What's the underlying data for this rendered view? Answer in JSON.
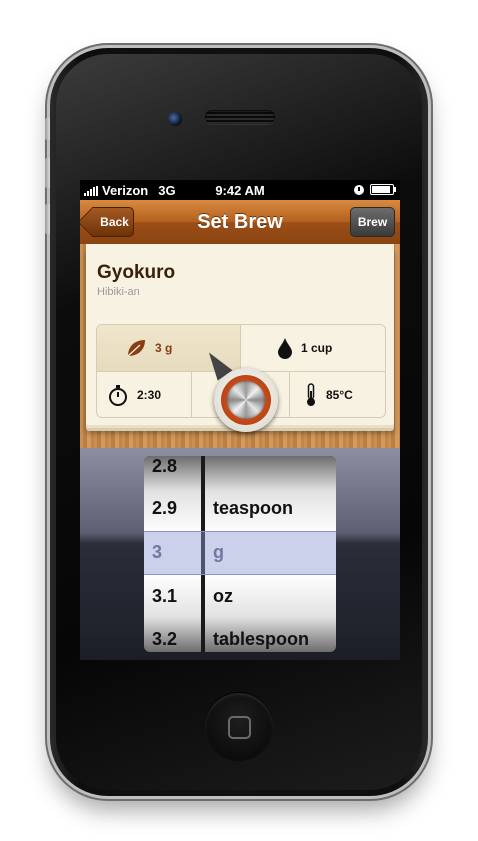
{
  "status_bar": {
    "carrier": "Verizon",
    "network": "3G",
    "time": "9:42 AM"
  },
  "nav": {
    "back_label": "Back",
    "title": "Set Brew",
    "brew_label": "Brew"
  },
  "tea": {
    "name": "Gyokuro",
    "vendor": "Hibiki-an"
  },
  "params": {
    "amount": "3 g",
    "water": "1 cup",
    "time": "2:30",
    "temperature": "85°C"
  },
  "picker": {
    "numbers": [
      "2.8",
      "2.9",
      "3",
      "3.1",
      "3.2"
    ],
    "units": [
      "teaspoon",
      "g",
      "oz",
      "tablespoon"
    ],
    "selected_number": "3",
    "selected_unit": "g",
    "selection_color": "#8c96d2"
  },
  "colors": {
    "nav_brown": "#b4601e",
    "card_bg": "#f7f2e1",
    "accent_red": "#a8320c"
  }
}
